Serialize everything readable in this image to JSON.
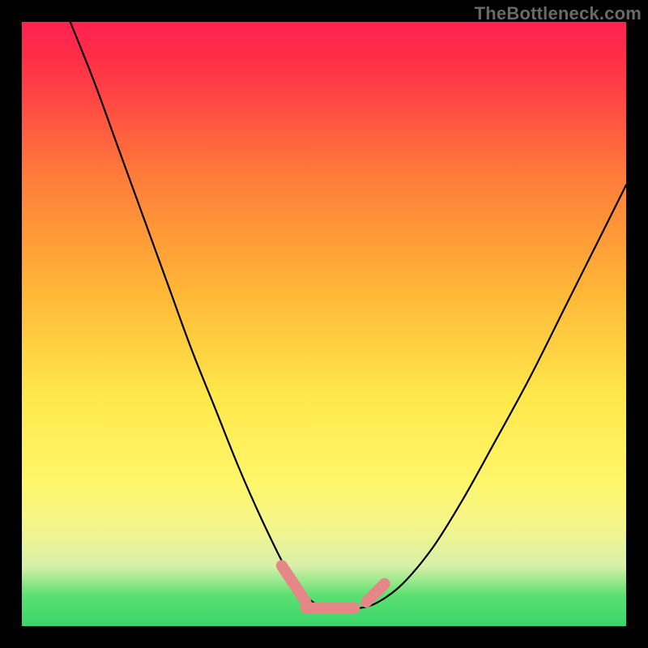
{
  "watermark": {
    "text": "TheBottleneck.com"
  },
  "chart_data": {
    "type": "line",
    "title": "",
    "xlabel": "",
    "ylabel": "",
    "xlim": [
      0,
      100
    ],
    "ylim": [
      0,
      100
    ],
    "grid": false,
    "notes": "V-shaped bottleneck curve on a vertical red→green gradient. Y≈100 is top (worst / red), Y≈0 is bottom (best / green). Minimum plateau near x≈46–58 at y≈3. Pink capsule markers sit on the plateau.",
    "series": [
      {
        "name": "bottleneck-curve",
        "x": [
          8,
          12,
          16,
          20,
          24,
          28,
          32,
          36,
          40,
          44,
          47,
          50,
          53,
          56,
          59,
          63,
          68,
          73,
          78,
          84,
          90,
          96,
          100
        ],
        "values": [
          100,
          90,
          79,
          68,
          57,
          46,
          36,
          26,
          17,
          9,
          5,
          3,
          3,
          3,
          4,
          7,
          13,
          21,
          30,
          41,
          53,
          65,
          73
        ]
      }
    ],
    "markers": [
      {
        "name": "plateau-left",
        "x_range": [
          43,
          47
        ],
        "y_range": [
          10,
          4
        ]
      },
      {
        "name": "plateau-middle",
        "x_range": [
          47,
          55
        ],
        "y_range": [
          3,
          3
        ]
      },
      {
        "name": "plateau-right",
        "x_range": [
          57,
          60
        ],
        "y_range": [
          4,
          7
        ]
      }
    ],
    "gradient_stops": [
      {
        "pct": 0,
        "color": "#ff1a4a"
      },
      {
        "pct": 25,
        "color": "#ff7a3a"
      },
      {
        "pct": 62,
        "color": "#ffe84b"
      },
      {
        "pct": 90,
        "color": "#d8f0a9"
      },
      {
        "pct": 100,
        "color": "#39d66c"
      }
    ]
  }
}
